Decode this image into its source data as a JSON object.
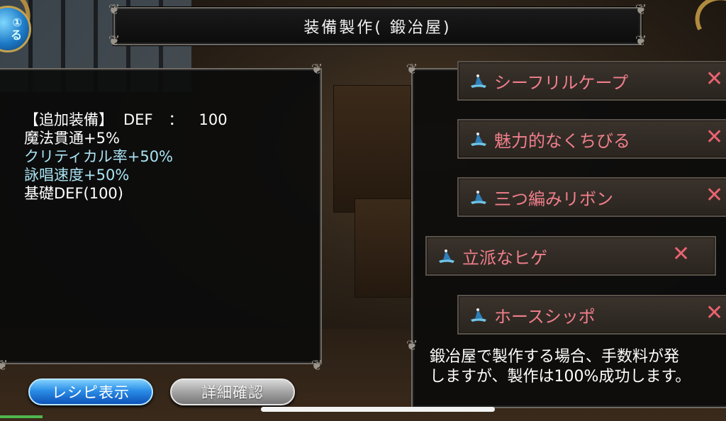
{
  "title": "装備製作(  鍛冶屋)",
  "menu_orb": {
    "line1": "①",
    "line2": "る"
  },
  "info": {
    "header_label": "【追加装備】",
    "header_stat": "DEF",
    "header_sep": "：",
    "header_value": "100",
    "lines": [
      {
        "text": "魔法貫通+5%",
        "color": "white"
      },
      {
        "text": "クリティカル率+50%",
        "color": "cyan"
      },
      {
        "text": "詠唱速度+50%",
        "color": "cyan"
      },
      {
        "text": "基礎DEF(100)",
        "color": "white"
      }
    ]
  },
  "items": [
    {
      "name": "シーフリルケープ",
      "icon": "wizard-hat-icon",
      "selected": false
    },
    {
      "name": "魅力的なくちびる",
      "icon": "wizard-hat-icon",
      "selected": false
    },
    {
      "name": "三つ編みリボン",
      "icon": "wizard-hat-icon",
      "selected": false
    },
    {
      "name": "立派なヒゲ",
      "icon": "wizard-hat-icon",
      "selected": true
    },
    {
      "name": "ホースシッポ",
      "icon": "wizard-hat-icon",
      "selected": false
    }
  ],
  "remove_symbol": "✕",
  "description": {
    "line1": "鍛冶屋で製作する場合、手数料が発",
    "line2": "しますが、製作は100%成功します。"
  },
  "buttons": {
    "recipe": "レシピ表示",
    "detail": "詳細確認"
  },
  "colors": {
    "item_name": "#f07f8b",
    "remove_x": "#e8636f",
    "cyan_text": "#a9e3f2",
    "recipe_button": "#2b8de6",
    "detail_button": "#a3a3a3"
  }
}
